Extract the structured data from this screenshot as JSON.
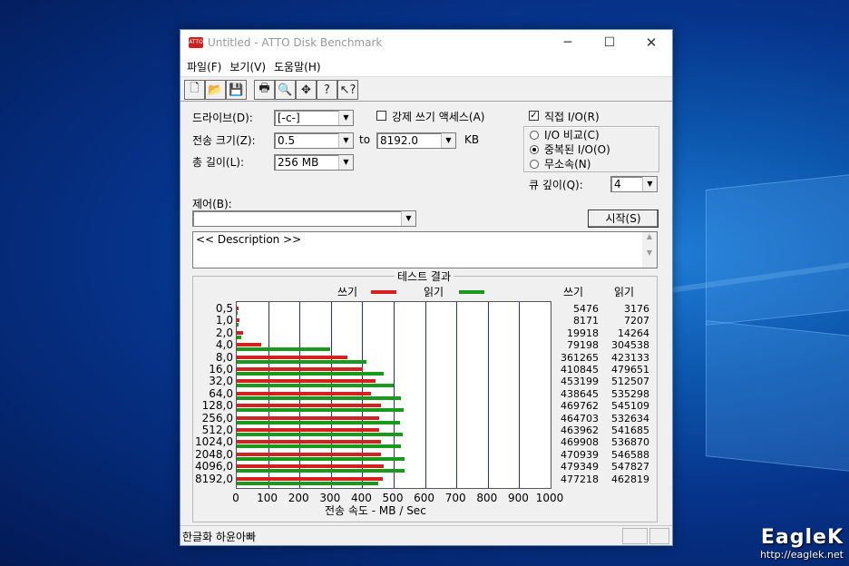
{
  "window": {
    "title": "Untitled - ATTO Disk Benchmark",
    "controls": {
      "minimize": "─",
      "maximize": "☐",
      "close": "✕"
    }
  },
  "menu": [
    "파일(F)",
    "보기(V)",
    "도움말(H)"
  ],
  "toolbar_icons": [
    "new-file-icon",
    "open-folder-icon",
    "save-icon",
    "print-icon",
    "print-preview-icon",
    "move-icon",
    "help-icon",
    "context-help-icon"
  ],
  "settings": {
    "drive_label": "드라이브(D):",
    "drive_value": "[-c-]",
    "transfer_label": "전송 크기(Z):",
    "transfer_from": "0.5",
    "transfer_to_label": "to",
    "transfer_to": "8192.0",
    "transfer_unit": "KB",
    "total_label": "총 길이(L):",
    "total_value": "256 MB",
    "force_write_label": "강제 쓰기 액세스(A)",
    "force_write_checked": false,
    "direct_io_label": "직접 I/O(R)",
    "direct_io_checked": true,
    "io_options": [
      {
        "label": "I/O 비교(C)",
        "selected": false
      },
      {
        "label": "중복된 I/O(O)",
        "selected": true
      },
      {
        "label": "무소속(N)",
        "selected": false
      }
    ],
    "queue_label": "큐 깊이(Q):",
    "queue_value": "4",
    "control_label": "제어(B):",
    "control_value": "",
    "start_button": "시작(S)",
    "description": "<< Description >>"
  },
  "results": {
    "title": "테스트 결과",
    "legend_write": "쓰기",
    "legend_read": "읽기",
    "col_write": "쓰기",
    "col_read": "읽기",
    "write_color": "#d42020",
    "read_color": "#1a9a1a"
  },
  "chart_data": {
    "type": "bar",
    "orientation": "horizontal",
    "categories": [
      "0.5",
      "1.0",
      "2.0",
      "4.0",
      "8.0",
      "16.0",
      "32.0",
      "64.0",
      "128.0",
      "256.0",
      "512.0",
      "1024.0",
      "2048.0",
      "4096.0",
      "8192.0"
    ],
    "series": [
      {
        "name": "쓰기",
        "values": [
          5476,
          8171,
          19918,
          79198,
          361265,
          410845,
          453199,
          438645,
          469762,
          464703,
          463962,
          469908,
          470939,
          479349,
          477218
        ]
      },
      {
        "name": "읽기",
        "values": [
          3176,
          7207,
          14264,
          304538,
          423133,
          479651,
          512507,
          535298,
          545109,
          532634,
          541685,
          536870,
          546588,
          547827,
          462819
        ]
      }
    ],
    "xticks": [
      "0",
      "100",
      "200",
      "300",
      "400",
      "500",
      "600",
      "700",
      "800",
      "900",
      "1000"
    ],
    "xlim": [
      0,
      1000
    ],
    "xlabel": "전송 속도 - MB / Sec",
    "grid": true
  },
  "status": {
    "text": "한글화 하윤아빠"
  },
  "watermark": {
    "logo": "EagleK",
    "url": "http://eaglek.net"
  }
}
